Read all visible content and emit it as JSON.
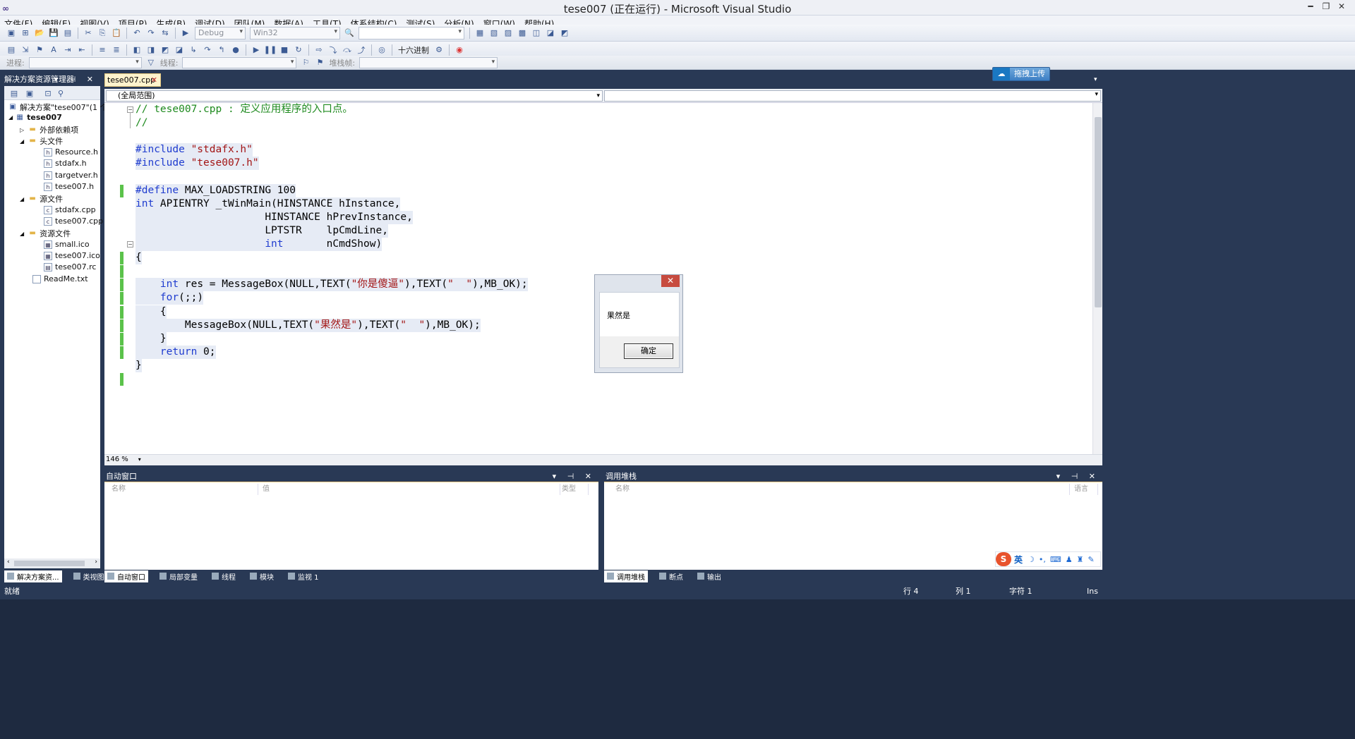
{
  "window": {
    "title": "tese007 (正在运行) - Microsoft Visual Studio",
    "logo": "∞"
  },
  "menu": [
    "文件(F)",
    "编辑(E)",
    "视图(V)",
    "项目(P)",
    "生成(B)",
    "调试(D)",
    "团队(M)",
    "数据(A)",
    "工具(T)",
    "体系结构(C)",
    "测试(S)",
    "分析(N)",
    "窗口(W)",
    "帮助(H)"
  ],
  "toolbar": {
    "config": "Debug",
    "platform": "Win32",
    "hex_label": "十六进制"
  },
  "debugbar": {
    "process_label": "进程:",
    "thread_label": "线程:",
    "stack_label": "堆栈帧:"
  },
  "solution_explorer": {
    "title": "解决方案资源管理器",
    "items": [
      {
        "label": "解决方案\"tese007\"(1 个项",
        "icon": "solution-icon"
      },
      {
        "label": "tese007",
        "icon": "project-icon"
      },
      {
        "label": "外部依赖项",
        "icon": "folder-icon"
      },
      {
        "label": "头文件",
        "icon": "folder-icon"
      },
      {
        "label": "Resource.h",
        "icon": "header-file-icon"
      },
      {
        "label": "stdafx.h",
        "icon": "header-file-icon"
      },
      {
        "label": "targetver.h",
        "icon": "header-file-icon"
      },
      {
        "label": "tese007.h",
        "icon": "header-file-icon"
      },
      {
        "label": "源文件",
        "icon": "folder-icon"
      },
      {
        "label": "stdafx.cpp",
        "icon": "cpp-file-icon"
      },
      {
        "label": "tese007.cpp",
        "icon": "cpp-file-icon"
      },
      {
        "label": "资源文件",
        "icon": "folder-icon"
      },
      {
        "label": "small.ico",
        "icon": "ico-file-icon"
      },
      {
        "label": "tese007.ico",
        "icon": "ico-file-icon"
      },
      {
        "label": "tese007.rc",
        "icon": "rc-file-icon"
      },
      {
        "label": "ReadMe.txt",
        "icon": "text-file-icon"
      }
    ],
    "tabs": [
      "解决方案资...",
      "类视图"
    ]
  },
  "editor": {
    "tab": "tese007.cpp",
    "scope": "(全局范围)",
    "zoom": "146 %",
    "upload_button": "拖拽上传"
  },
  "code_lines": [
    {
      "segs": [
        {
          "t": "// tese007.cpp : 定义应用程序的入口点。",
          "c": "cm"
        }
      ]
    },
    {
      "segs": [
        {
          "t": "//",
          "c": "cm"
        }
      ]
    },
    {
      "segs": [
        {
          "t": "",
          "c": ""
        }
      ]
    },
    {
      "segs": [
        {
          "t": "#include ",
          "c": "kw"
        },
        {
          "t": "\"stdafx.h\"",
          "c": "str"
        }
      ]
    },
    {
      "segs": [
        {
          "t": "#include ",
          "c": "kw"
        },
        {
          "t": "\"tese007.h\"",
          "c": "str"
        }
      ]
    },
    {
      "segs": [
        {
          "t": "",
          "c": ""
        }
      ]
    },
    {
      "segs": [
        {
          "t": "#define ",
          "c": "kw"
        },
        {
          "t": "MAX_LOADSTRING 100",
          "c": ""
        }
      ]
    },
    {
      "segs": [
        {
          "t": "int ",
          "c": "kw"
        },
        {
          "t": "APIENTRY _tWinMain(HINSTANCE hInstance,",
          "c": ""
        }
      ]
    },
    {
      "segs": [
        {
          "t": "                     HINSTANCE hPrevInstance,",
          "c": ""
        }
      ]
    },
    {
      "segs": [
        {
          "t": "                     LPTSTR    lpCmdLine,",
          "c": ""
        }
      ]
    },
    {
      "segs": [
        {
          "t": "                     ",
          "c": ""
        },
        {
          "t": "int",
          "c": "kw"
        },
        {
          "t": "       nCmdShow)",
          "c": ""
        }
      ]
    },
    {
      "segs": [
        {
          "t": "{",
          "c": ""
        }
      ]
    },
    {
      "segs": [
        {
          "t": "",
          "c": ""
        }
      ]
    },
    {
      "segs": [
        {
          "t": "    ",
          "c": ""
        },
        {
          "t": "int",
          "c": "kw"
        },
        {
          "t": " res = MessageBox(NULL,TEXT(",
          "c": ""
        },
        {
          "t": "\"你是傻逼\"",
          "c": "str"
        },
        {
          "t": "),TEXT(",
          "c": ""
        },
        {
          "t": "\"  \"",
          "c": "str"
        },
        {
          "t": "),MB_OK);",
          "c": ""
        }
      ]
    },
    {
      "segs": [
        {
          "t": "    ",
          "c": ""
        },
        {
          "t": "for",
          "c": "kw"
        },
        {
          "t": "(;;)",
          "c": ""
        }
      ]
    },
    {
      "segs": [
        {
          "t": "    {",
          "c": ""
        }
      ]
    },
    {
      "segs": [
        {
          "t": "        MessageBox(NULL,TEXT(",
          "c": ""
        },
        {
          "t": "\"果然是\"",
          "c": "str"
        },
        {
          "t": "),TEXT(",
          "c": ""
        },
        {
          "t": "\"  \"",
          "c": "str"
        },
        {
          "t": "),MB_OK);",
          "c": ""
        }
      ]
    },
    {
      "segs": [
        {
          "t": "    }",
          "c": ""
        }
      ]
    },
    {
      "segs": [
        {
          "t": "    ",
          "c": ""
        },
        {
          "t": "return",
          "c": "kw"
        },
        {
          "t": " 0;",
          "c": ""
        }
      ]
    },
    {
      "segs": [
        {
          "t": "}",
          "c": ""
        }
      ]
    }
  ],
  "messagebox": {
    "text": "果然是",
    "ok_label": "确定",
    "close": "✕"
  },
  "auto_window": {
    "title": "自动窗口",
    "columns": [
      "名称",
      "值",
      "类型"
    ]
  },
  "call_stack": {
    "title": "调用堆栈",
    "columns": [
      "名称",
      "语言"
    ]
  },
  "bottom_tabs_left": [
    "自动窗口",
    "局部变量",
    "线程",
    "模块",
    "监视 1"
  ],
  "bottom_tabs_right": [
    "调用堆栈",
    "断点",
    "输出"
  ],
  "status": {
    "ready": "就绪",
    "line": "行 4",
    "col": "列 1",
    "char": "字符 1",
    "mode": "Ins"
  },
  "ime": {
    "lang": "英"
  }
}
